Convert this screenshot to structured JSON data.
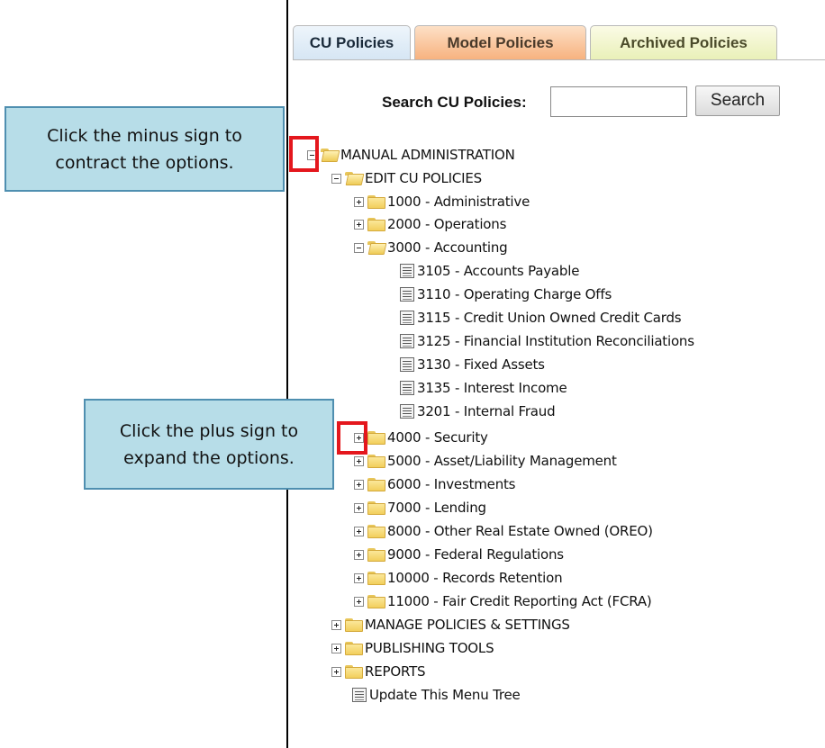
{
  "tabs": [
    {
      "label": "CU Policies"
    },
    {
      "label": "Model Policies"
    },
    {
      "label": "Archived Policies"
    }
  ],
  "search": {
    "label": "Search CU Policies:",
    "value": "",
    "button_label": "Search"
  },
  "tree": {
    "root": {
      "label": "MANUAL ADMINISTRATION",
      "toggle": "minus"
    },
    "edit": {
      "label": "EDIT CU POLICIES",
      "toggle": "minus"
    },
    "categories": [
      {
        "label": "1000 - Administrative",
        "toggle": "plus"
      },
      {
        "label": "2000 - Operations",
        "toggle": "plus"
      },
      {
        "label": "3000 - Accounting",
        "toggle": "minus"
      }
    ],
    "accounting_policies": [
      {
        "label": "3105 - Accounts Payable"
      },
      {
        "label": "3110 - Operating Charge Offs"
      },
      {
        "label": "3115 - Credit Union Owned Credit Cards"
      },
      {
        "label": "3125 - Financial Institution Reconciliations"
      },
      {
        "label": "3130 - Fixed Assets"
      },
      {
        "label": "3135 - Interest Income"
      },
      {
        "label": "3201 - Internal Fraud"
      }
    ],
    "more_categories": [
      {
        "label": "4000 - Security",
        "toggle": "plus"
      },
      {
        "label": "5000 - Asset/Liability Management",
        "toggle": "plus"
      },
      {
        "label": "6000 - Investments",
        "toggle": "plus"
      },
      {
        "label": "7000 - Lending",
        "toggle": "plus"
      },
      {
        "label": "8000 - Other Real Estate Owned (OREO)",
        "toggle": "plus"
      },
      {
        "label": "9000 - Federal Regulations",
        "toggle": "plus"
      },
      {
        "label": "10000 - Records Retention",
        "toggle": "plus"
      },
      {
        "label": "11000 - Fair Credit Reporting Act (FCRA)",
        "toggle": "plus"
      }
    ],
    "top_sections": [
      {
        "label": "MANAGE POLICIES & SETTINGS",
        "toggle": "plus"
      },
      {
        "label": "PUBLISHING TOOLS",
        "toggle": "plus"
      },
      {
        "label": "REPORTS",
        "toggle": "plus"
      }
    ],
    "update_item": {
      "label": "Update This Menu Tree"
    }
  },
  "callouts": {
    "minus_line1": "Click the minus sign to",
    "minus_line2": "contract the options.",
    "plus_line1": "Click the plus sign to",
    "plus_line2": "expand the options."
  },
  "colors": {
    "callout_fill": "#b7dde8",
    "callout_border": "#4f8fb0",
    "highlight": "#e4171d",
    "folder": "#f2cf5c"
  }
}
